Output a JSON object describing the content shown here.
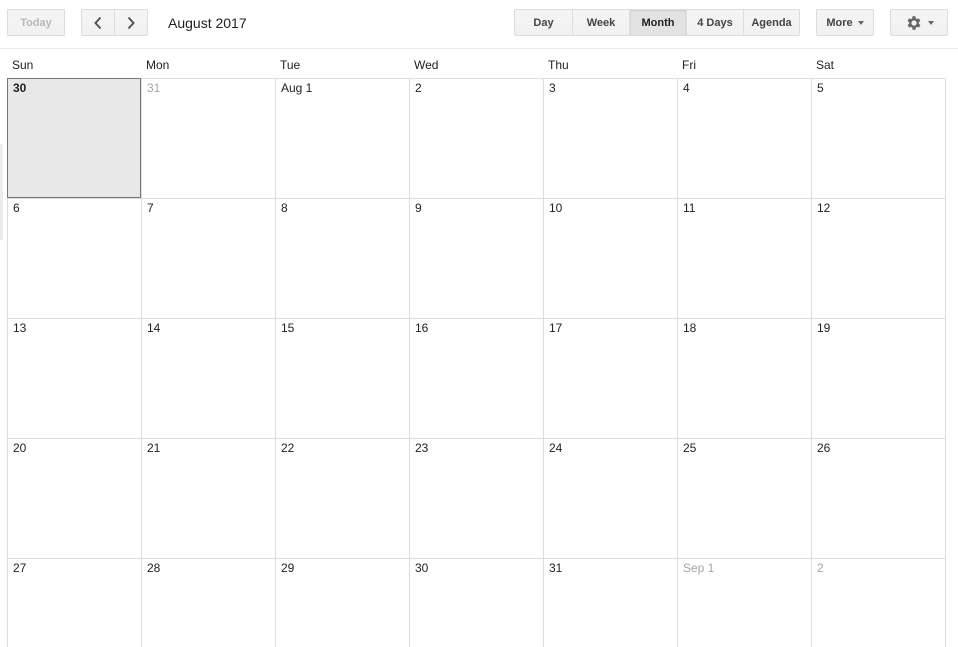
{
  "toolbar": {
    "today_label": "Today",
    "prev_icon": "chevron-left-icon",
    "next_icon": "chevron-right-icon",
    "title": "August 2017",
    "views": [
      {
        "label": "Day",
        "active": false
      },
      {
        "label": "Week",
        "active": false
      },
      {
        "label": "Month",
        "active": true
      },
      {
        "label": "4 Days",
        "active": false
      },
      {
        "label": "Agenda",
        "active": false
      }
    ],
    "more_label": "More",
    "settings_icon": "gear-icon"
  },
  "calendar": {
    "weekdays": [
      "Sun",
      "Mon",
      "Tue",
      "Wed",
      "Thu",
      "Fri",
      "Sat"
    ],
    "weeks": [
      [
        {
          "label": "30",
          "other": false,
          "today": true
        },
        {
          "label": "31",
          "other": true
        },
        {
          "label": "Aug 1"
        },
        {
          "label": "2"
        },
        {
          "label": "3"
        },
        {
          "label": "4"
        },
        {
          "label": "5"
        }
      ],
      [
        {
          "label": "6"
        },
        {
          "label": "7"
        },
        {
          "label": "8"
        },
        {
          "label": "9"
        },
        {
          "label": "10"
        },
        {
          "label": "11"
        },
        {
          "label": "12"
        }
      ],
      [
        {
          "label": "13"
        },
        {
          "label": "14"
        },
        {
          "label": "15"
        },
        {
          "label": "16"
        },
        {
          "label": "17"
        },
        {
          "label": "18"
        },
        {
          "label": "19"
        }
      ],
      [
        {
          "label": "20"
        },
        {
          "label": "21"
        },
        {
          "label": "22"
        },
        {
          "label": "23"
        },
        {
          "label": "24"
        },
        {
          "label": "25"
        },
        {
          "label": "26"
        }
      ],
      [
        {
          "label": "27"
        },
        {
          "label": "28"
        },
        {
          "label": "29"
        },
        {
          "label": "30"
        },
        {
          "label": "31"
        },
        {
          "label": "Sep 1",
          "other": true
        },
        {
          "label": "2",
          "other": true
        }
      ]
    ]
  }
}
